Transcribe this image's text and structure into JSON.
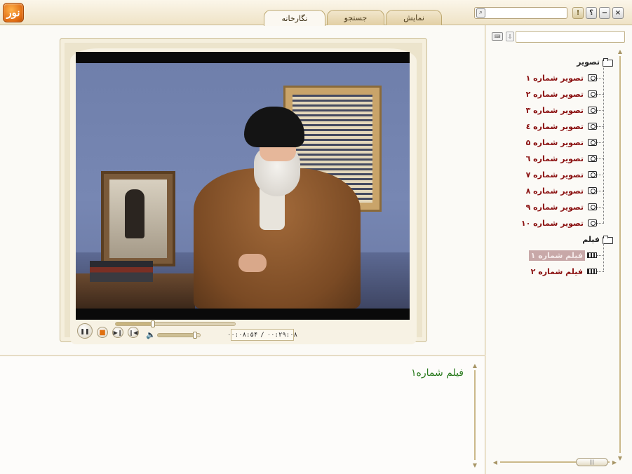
{
  "window": {
    "logo_text": "نور",
    "search_placeholder": "",
    "search_icon": "search-icon",
    "buttons": {
      "warning": "!",
      "help": "؟",
      "minimize": "−",
      "close": "×"
    }
  },
  "tabs": [
    {
      "label": "نگارخانه",
      "active": true
    },
    {
      "label": "جستجو",
      "active": false
    },
    {
      "label": "نمایش",
      "active": false
    }
  ],
  "player": {
    "time_current": "۰۰:۰۸:۵۴",
    "time_separator": "/",
    "time_total": "۰۰:۲۹:۰۸",
    "seek_progress": 0.31,
    "volume_level": 0.85,
    "buttons": {
      "pause": "❚❚",
      "stop": "■",
      "next": "▶❙",
      "prev": "❙◀",
      "volume": "🔈"
    }
  },
  "caption": {
    "text": "فیلم شماره۱"
  },
  "sidebar": {
    "filter_value": "",
    "tree": [
      {
        "label": "تصویر",
        "type": "folder",
        "children": [
          {
            "label": "تصویر شماره ۱",
            "type": "image"
          },
          {
            "label": "تصویر شماره ۲",
            "type": "image"
          },
          {
            "label": "تصویر شماره ۳",
            "type": "image"
          },
          {
            "label": "تصویر شماره ٤",
            "type": "image"
          },
          {
            "label": "تصویر شماره ۵",
            "type": "image"
          },
          {
            "label": "تصویر شماره ٦",
            "type": "image"
          },
          {
            "label": "تصویر شماره ۷",
            "type": "image"
          },
          {
            "label": "تصویر شماره ۸",
            "type": "image"
          },
          {
            "label": "تصویر شماره ۹",
            "type": "image"
          },
          {
            "label": "تصویر شماره ۱۰",
            "type": "image"
          }
        ]
      },
      {
        "label": "فیلم",
        "type": "folder",
        "children": [
          {
            "label": "فیلم شماره ۱",
            "type": "film",
            "selected": true
          },
          {
            "label": "فیلم شماره ۲",
            "type": "film",
            "selected": false
          }
        ]
      }
    ]
  },
  "colors": {
    "accent_orange": "#e06a10",
    "tree_item_red": "#8a1010",
    "caption_green": "#2a7a1e",
    "frame_beige": "#ece4cc"
  }
}
